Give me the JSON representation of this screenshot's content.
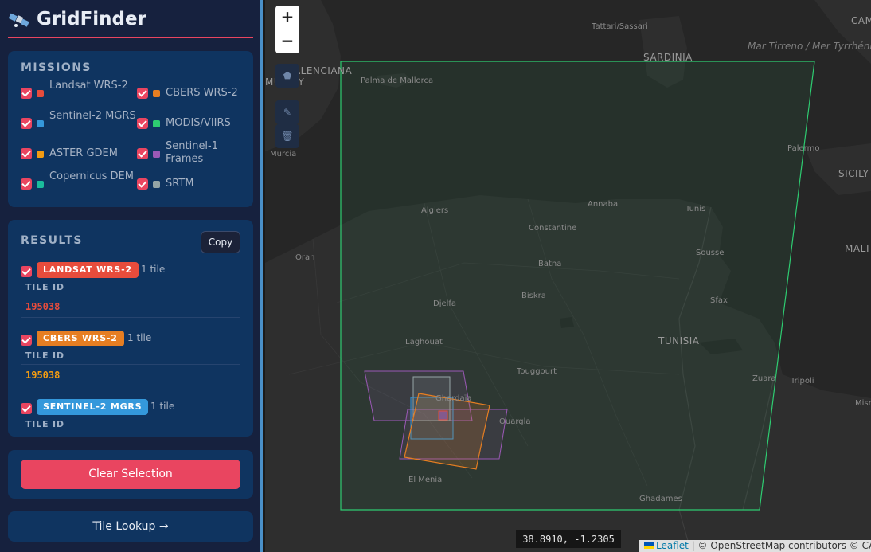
{
  "app": {
    "title": "GridFinder"
  },
  "missions": {
    "title": "MISSIONS",
    "items": [
      {
        "label": "Landsat WRS-2",
        "color": "#e74c3c"
      },
      {
        "label": "CBERS WRS-2",
        "color": "#e67e22"
      },
      {
        "label": "Sentinel-2 MGRS",
        "color": "#3498db"
      },
      {
        "label": "MODIS/VIIRS",
        "color": "#2ecc71"
      },
      {
        "label": "ASTER GDEM",
        "color": "#f39c12"
      },
      {
        "label": "Sentinel-1 Frames",
        "color": "#9b59b6"
      },
      {
        "label": "Copernicus DEM",
        "color": "#1abc9c"
      },
      {
        "label": "SRTM",
        "color": "#95a5a6"
      }
    ]
  },
  "results": {
    "title": "RESULTS",
    "copy_label": "Copy",
    "groups": [
      {
        "badge": "LANDSAT WRS-2",
        "color": "#e74c3c",
        "count": "1 tile",
        "column": "TILE ID",
        "tile_id": "195038",
        "id_color": "#e74c3c"
      },
      {
        "badge": "CBERS WRS-2",
        "color": "#e67e22",
        "count": "1 tile",
        "column": "TILE ID",
        "tile_id": "195038",
        "id_color": "#f39c12"
      },
      {
        "badge": "SENTINEL-2 MGRS",
        "color": "#3498db",
        "count": "1 tile",
        "column": "TILE ID",
        "tile_id": "",
        "id_color": "#3498db"
      }
    ]
  },
  "actions": {
    "clear_label": "Clear Selection",
    "lookup_label": "Tile Lookup →"
  },
  "map": {
    "zoom_in": "+",
    "zoom_out": "−",
    "coords": "38.8910, -1.2305",
    "attribution_leaflet": "Leaflet",
    "attribution_rest": " | © OpenStreetMap contributors © CARTO",
    "labels": [
      "Tattari/Sassari",
      "CAM",
      "SARDINIA",
      "Mar Tirreno / Mer Tyrrhénienne",
      "VALENCIANA",
      "MUNITY",
      "Palma de Mallorca",
      "Murcia",
      "Palermo",
      "SICILY",
      "Algiers",
      "Annaba",
      "Tunis",
      "Constantine",
      "Oran",
      "Batna",
      "Sousse",
      "MALT",
      "Djelfa",
      "Biskra",
      "Sfax",
      "Laghouat",
      "TUNISIA",
      "Touggourt",
      "Ghardaïa",
      "Zuara",
      "Tripoli",
      "Misr",
      "Ouargla",
      "El Menia",
      "Ghadames"
    ]
  }
}
